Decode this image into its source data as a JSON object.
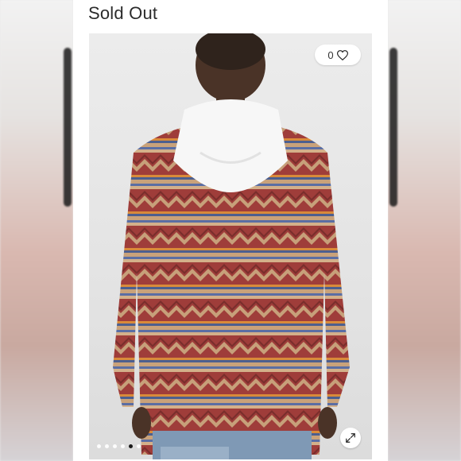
{
  "listing": {
    "status_label": "Sold Out"
  },
  "gallery": {
    "like_count": "0",
    "dots_total": 6,
    "active_dot_index": 4
  },
  "colors": {
    "card_background": "#ffffff",
    "pattern_red": "#a8433f",
    "pattern_tan": "#c9a27a",
    "pattern_blue": "#5b6ea3",
    "hoodie": "#f7f7f7"
  }
}
